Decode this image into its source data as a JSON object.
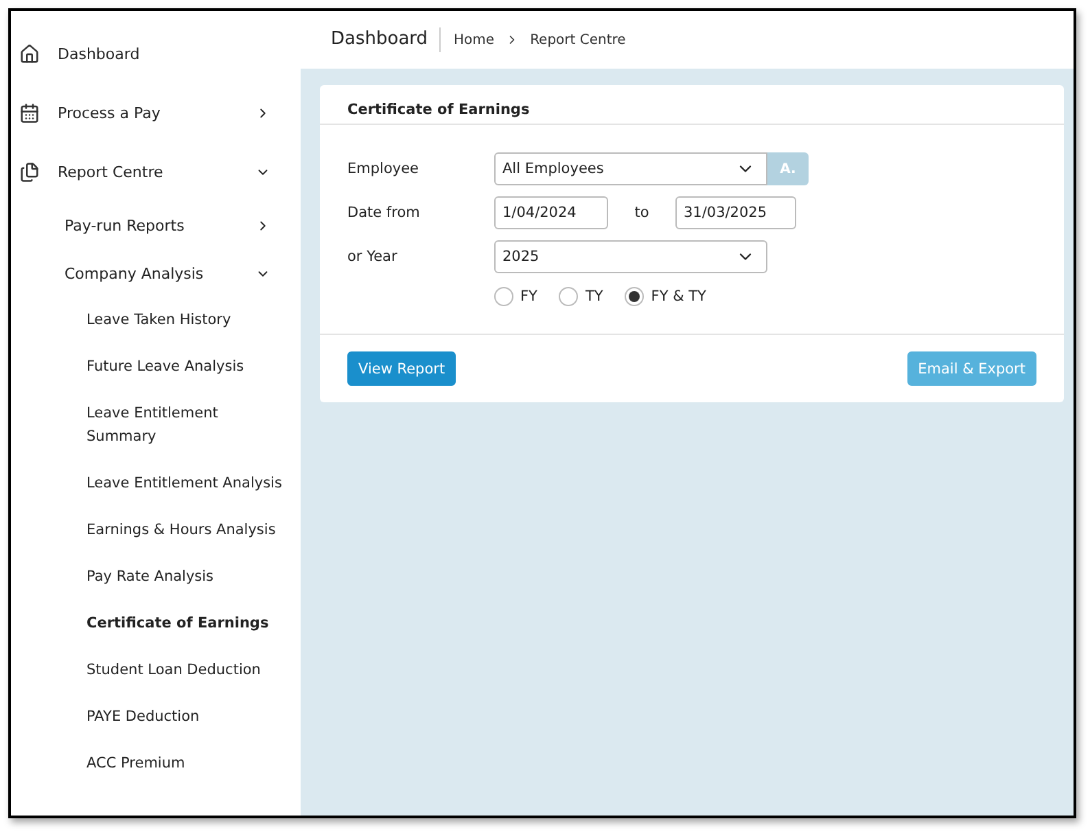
{
  "sidebar": {
    "items": [
      {
        "label": "Dashboard"
      },
      {
        "label": "Process a Pay",
        "expanded": false
      },
      {
        "label": "Report Centre",
        "expanded": true,
        "children": [
          {
            "label": "Pay-run Reports",
            "expanded": false
          },
          {
            "label": "Company Analysis",
            "expanded": true,
            "children": [
              {
                "label": "Leave Taken History",
                "selected": false
              },
              {
                "label": "Future Leave Analysis",
                "selected": false
              },
              {
                "label": "Leave Entitlement Summary",
                "selected": false
              },
              {
                "label": "Leave Entitlement Analysis",
                "selected": false
              },
              {
                "label": "Earnings & Hours Analysis",
                "selected": false
              },
              {
                "label": "Pay Rate Analysis",
                "selected": false
              },
              {
                "label": "Certificate of Earnings",
                "selected": true
              },
              {
                "label": "Student Loan Deduction",
                "selected": false
              },
              {
                "label": "PAYE Deduction",
                "selected": false
              },
              {
                "label": "ACC Premium",
                "selected": false
              }
            ]
          }
        ]
      }
    ]
  },
  "header": {
    "title": "Dashboard",
    "breadcrumbs": [
      "Home",
      "Report Centre"
    ]
  },
  "card": {
    "title": "Certificate of Earnings",
    "employee": {
      "label": "Employee",
      "value": "All Employees",
      "button": "A.",
      "button_disabled": true
    },
    "date": {
      "label": "Date from",
      "from": "1/04/2024",
      "to_label": "to",
      "to": "31/03/2025"
    },
    "year": {
      "label": "or Year",
      "value": "2025"
    },
    "period_options": [
      {
        "label": "FY",
        "selected": false
      },
      {
        "label": "TY",
        "selected": false
      },
      {
        "label": "FY & TY",
        "selected": true
      }
    ],
    "buttons": [
      {
        "label": "View Report",
        "kind": "primary"
      },
      {
        "label": "Email & Export",
        "kind": "secondary"
      }
    ]
  }
}
